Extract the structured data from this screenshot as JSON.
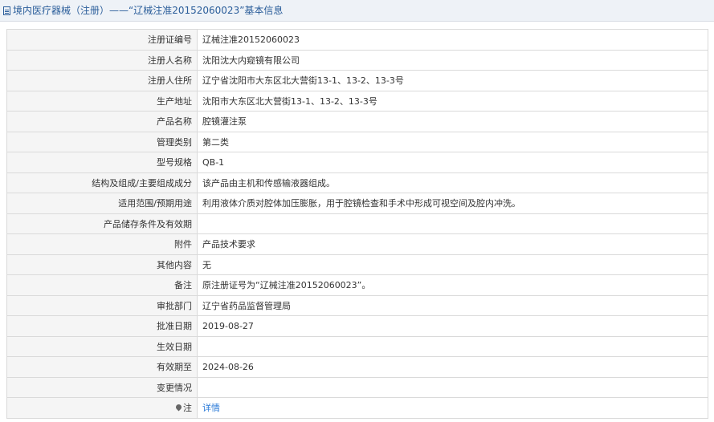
{
  "header": {
    "title": "境内医疗器械（注册）——“辽械注准20152060023”基本信息",
    "icon": "document-icon"
  },
  "rows": [
    {
      "label": "注册证编号",
      "value": "辽械注准20152060023"
    },
    {
      "label": "注册人名称",
      "value": "沈阳沈大内窥镜有限公司"
    },
    {
      "label": "注册人住所",
      "value": "辽宁省沈阳市大东区北大营街13-1、13-2、13-3号"
    },
    {
      "label": "生产地址",
      "value": "沈阳市大东区北大营街13-1、13-2、13-3号"
    },
    {
      "label": "产品名称",
      "value": "腔镜灌注泵"
    },
    {
      "label": "管理类别",
      "value": "第二类"
    },
    {
      "label": "型号规格",
      "value": "QB-1"
    },
    {
      "label": "结构及组成/主要组成成分",
      "value": "该产品由主机和传感输液器组成。"
    },
    {
      "label": "适用范围/预期用途",
      "value": "利用液体介质对腔体加压膨胀，用于腔镜检查和手术中形成可视空间及腔内冲洗。"
    },
    {
      "label": "产品储存条件及有效期",
      "value": ""
    },
    {
      "label": "附件",
      "value": "产品技术要求"
    },
    {
      "label": "其他内容",
      "value": "无"
    },
    {
      "label": "备注",
      "value": "原注册证号为“辽械注准20152060023”。"
    },
    {
      "label": "审批部门",
      "value": "辽宁省药品监督管理局"
    },
    {
      "label": "批准日期",
      "value": "2019-08-27"
    },
    {
      "label": "生效日期",
      "value": ""
    },
    {
      "label": "有效期至",
      "value": "2024-08-26"
    },
    {
      "label": "变更情况",
      "value": ""
    }
  ],
  "note_row": {
    "label": "注",
    "icon": "pin-icon",
    "link": "详情"
  }
}
